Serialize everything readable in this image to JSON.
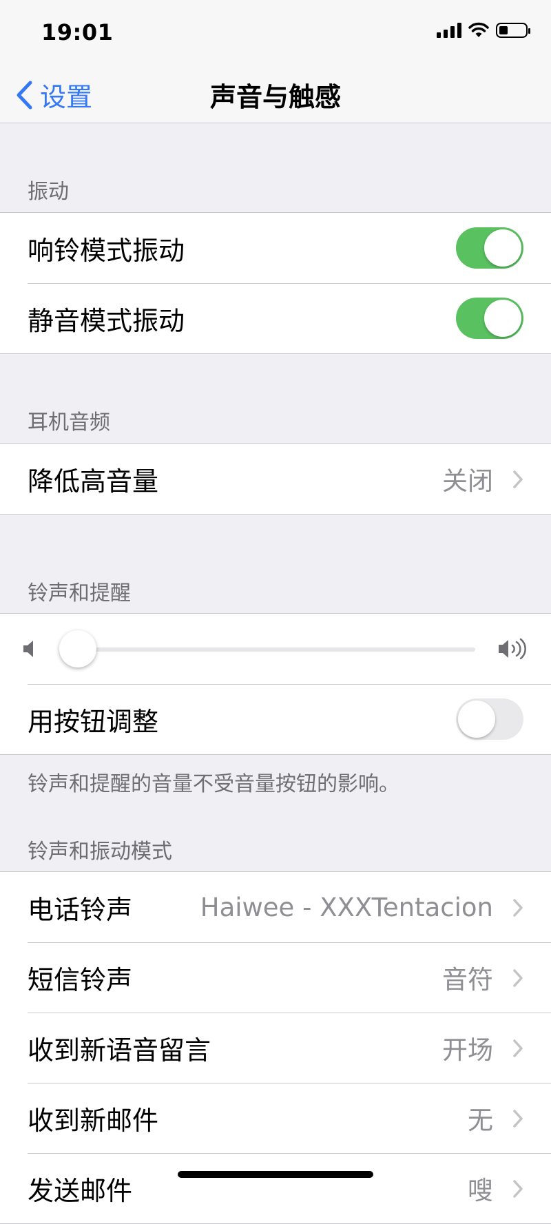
{
  "status_bar": {
    "time": "19:01"
  },
  "nav": {
    "back_label": "设置",
    "title": "声音与触感"
  },
  "vibration": {
    "header": "振动",
    "rows": [
      {
        "label": "响铃模式振动",
        "on": true
      },
      {
        "label": "静音模式振动",
        "on": true
      }
    ]
  },
  "headphone": {
    "header": "耳机音频",
    "rows": [
      {
        "label": "降低高音量",
        "value": "关闭"
      }
    ]
  },
  "ringer": {
    "header": "铃声和提醒",
    "volume_level": 0.0,
    "adjust_label": "用按钮调整",
    "adjust_on": false,
    "footer": "铃声和提醒的音量不受音量按钮的影响。"
  },
  "patterns": {
    "header": "铃声和振动模式",
    "rows": [
      {
        "label": "电话铃声",
        "value": "Haiwee - XXXTentacion"
      },
      {
        "label": "短信铃声",
        "value": "音符"
      },
      {
        "label": "收到新语音留言",
        "value": "开场"
      },
      {
        "label": "收到新邮件",
        "value": "无"
      },
      {
        "label": "发送邮件",
        "value": "嗖"
      }
    ]
  },
  "icons": {
    "back": "chevron-left-icon",
    "chevron": "chevron-right-icon",
    "volume_low": "speaker-low-icon",
    "volume_high": "speaker-high-icon"
  },
  "colors": {
    "accent": "#3478f6",
    "toggle_on": "#5ac161"
  }
}
